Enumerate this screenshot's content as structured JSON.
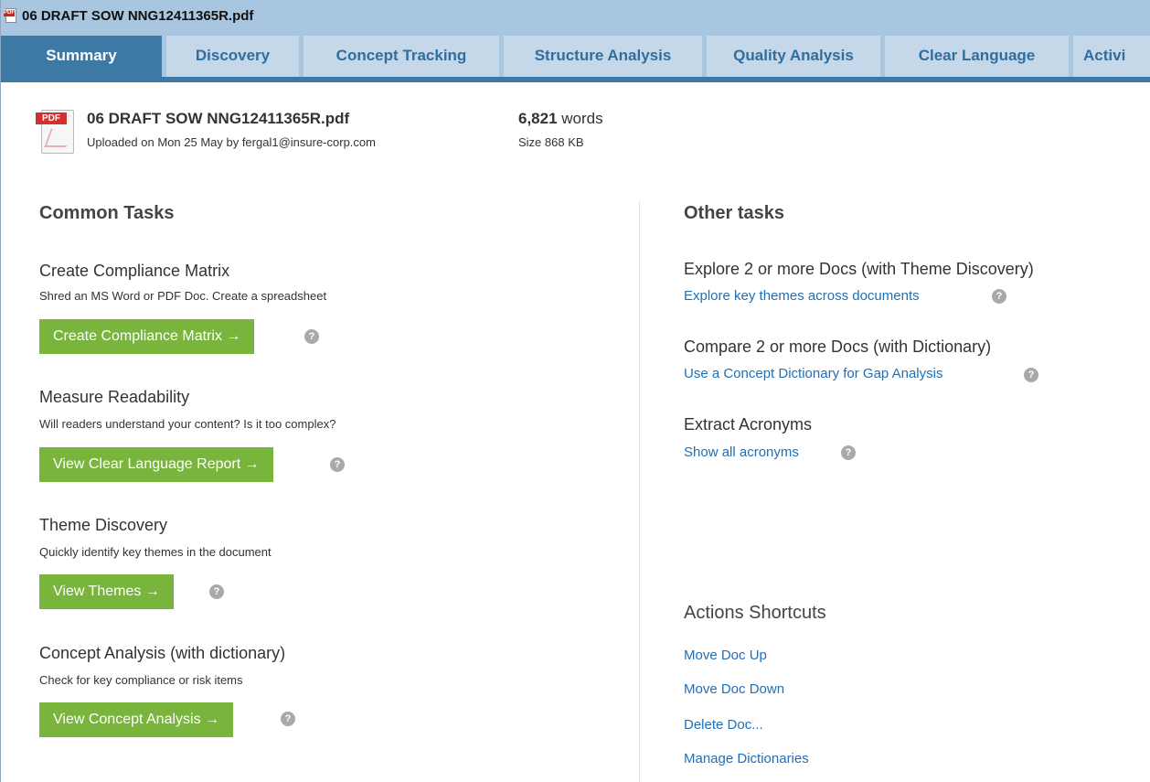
{
  "window": {
    "title": "06 DRAFT SOW NNG12411365R.pdf",
    "icon": "pdf-file-icon"
  },
  "tabs": [
    {
      "label": "Summary",
      "active": true
    },
    {
      "label": "Discovery"
    },
    {
      "label": "Concept Tracking"
    },
    {
      "label": "Structure Analysis"
    },
    {
      "label": "Quality Analysis"
    },
    {
      "label": "Clear Language"
    },
    {
      "label": "Activi"
    }
  ],
  "document": {
    "icon_label": "PDF",
    "name": "06 DRAFT SOW NNG12411365R.pdf",
    "uploaded": "Uploaded on Mon 25 May by fergal1@insure-corp.com",
    "word_count": "6,821",
    "words_label": " words",
    "size": "Size 868 KB"
  },
  "common_tasks": {
    "heading": "Common Tasks",
    "items": [
      {
        "title": "Create Compliance Matrix",
        "description": "Shred an MS Word or PDF Doc. Create a spreadsheet",
        "button": "Create Compliance Matrix →"
      },
      {
        "title": "Measure Readability",
        "description": "Will readers understand your content? Is it too complex?",
        "button": "View Clear Language Report →"
      },
      {
        "title": "Theme Discovery",
        "description": "Quickly identify key themes in the document",
        "button": "View Themes →"
      },
      {
        "title": "Concept Analysis (with dictionary)",
        "description": "Check for key compliance or risk items",
        "button": "View Concept Analysis →"
      }
    ]
  },
  "other_tasks": {
    "heading": "Other tasks",
    "items": [
      {
        "title": "Explore 2 or more Docs (with Theme Discovery)",
        "link": "Explore key themes across documents"
      },
      {
        "title": "Compare 2 or more Docs (with Dictionary)",
        "link": "Use a Concept Dictionary for Gap Analysis"
      },
      {
        "title": "Extract Acronyms",
        "link": "Show all acronyms"
      }
    ]
  },
  "actions_shortcuts": {
    "heading": "Actions Shortcuts",
    "items": [
      "Move Doc Up",
      "Move Doc Down",
      "Delete Doc...",
      "Manage Dictionaries"
    ]
  },
  "help_glyph": "?"
}
